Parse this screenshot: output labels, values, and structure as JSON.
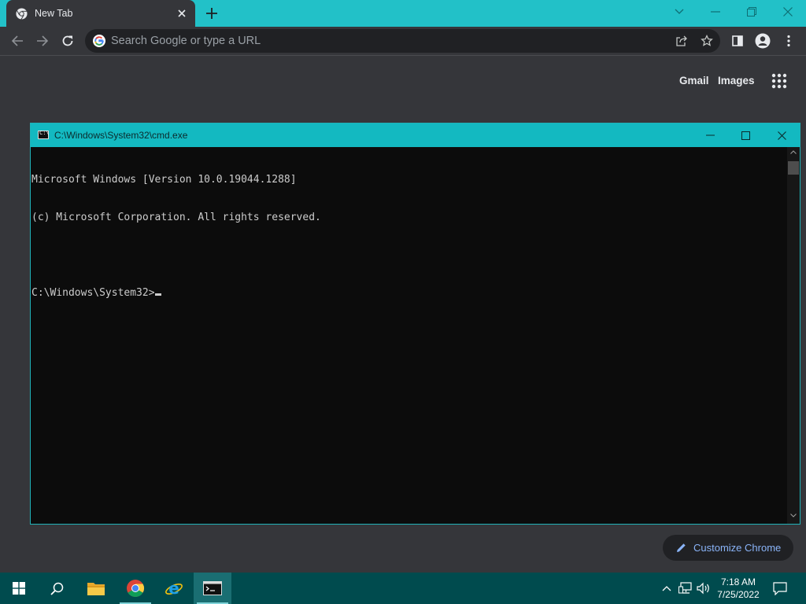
{
  "browser": {
    "tab": {
      "title": "New Tab"
    },
    "omnibox": {
      "placeholder": "Search Google or type a URL",
      "value": ""
    },
    "ntp": {
      "gmail_label": "Gmail",
      "images_label": "Images",
      "customize_label": "Customize Chrome"
    },
    "colors": {
      "frame": "#22c1c8",
      "toolbar": "#35363a",
      "link": "#8ab4f8"
    }
  },
  "cmd": {
    "title": "C:\\Windows\\System32\\cmd.exe",
    "icon_text": "C:\\",
    "lines": [
      "Microsoft Windows [Version 10.0.19044.1288]",
      "(c) Microsoft Corporation. All rights reserved.",
      "",
      "C:\\Windows\\System32>"
    ]
  },
  "taskbar": {
    "items": [
      "start-icon",
      "search-icon",
      "file-explorer-icon",
      "chrome-icon",
      "internet-explorer-icon",
      "cmd-icon"
    ],
    "active": "cmd-icon",
    "clock": {
      "time": "7:18 AM",
      "date": "7/25/2022"
    }
  }
}
